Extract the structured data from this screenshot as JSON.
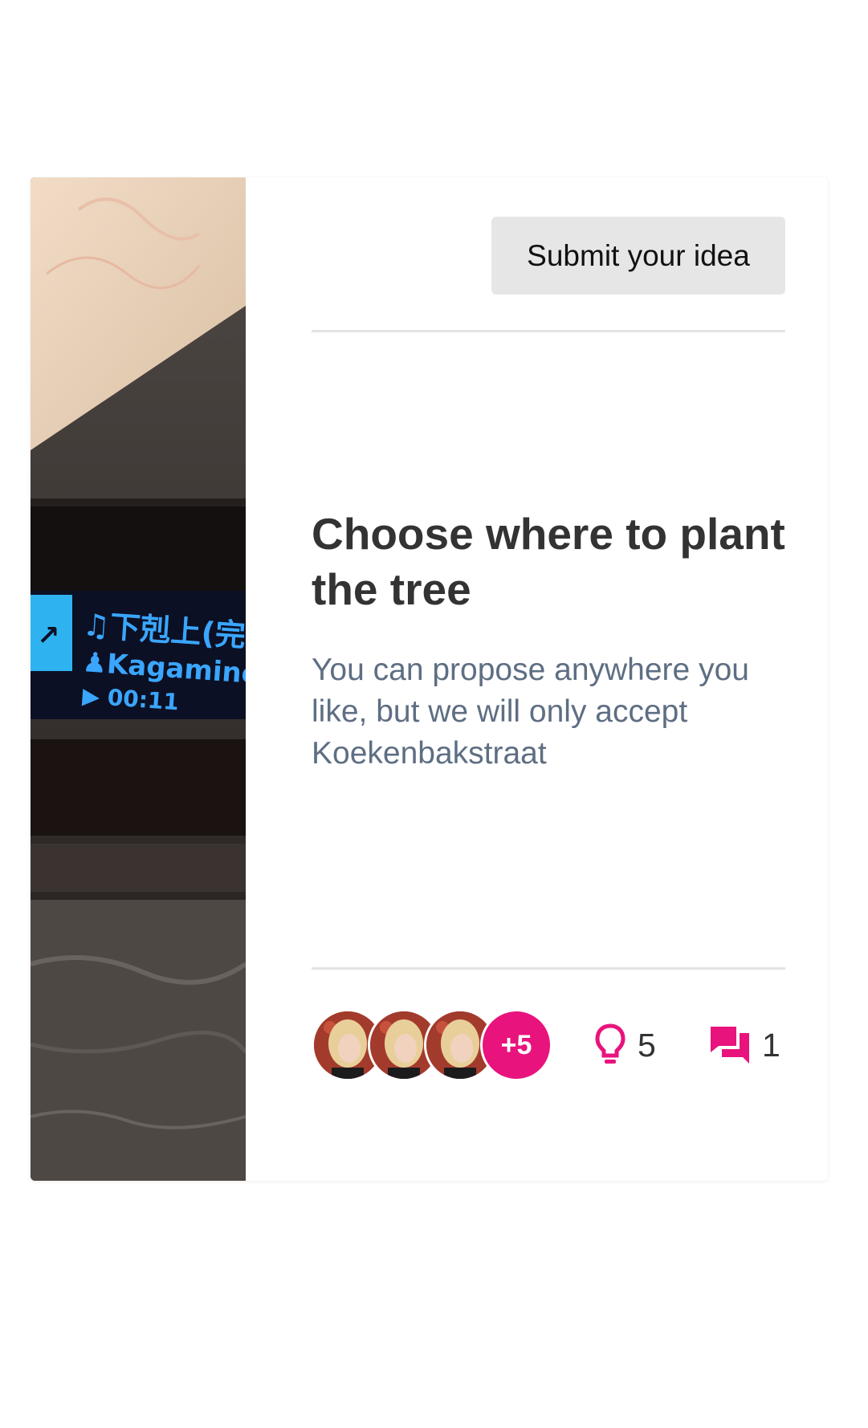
{
  "card": {
    "submit_label": "Submit your idea",
    "title": "Choose where to plant the tree",
    "description": "You can propose anywhere you like, but we will only accept Koekenbakstraat",
    "image": {
      "display_lines": [
        "♫下剋上(完",
        "Kagamine",
        "00:11"
      ]
    },
    "participants": {
      "avatar_count_shown": 3,
      "more_label": "+5"
    },
    "ideas_count": "5",
    "comments_count": "1",
    "icons": {
      "ideas": "lightbulb-icon",
      "comments": "chat-bubbles-icon"
    },
    "colors": {
      "accent": "#e8137d",
      "button_bg": "#e6e6e6",
      "title": "#333333",
      "description": "#5e6e83"
    }
  }
}
